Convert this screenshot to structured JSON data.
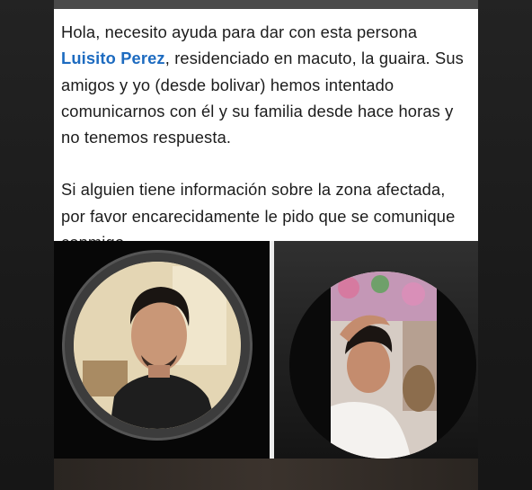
{
  "post": {
    "text_before_name": "Hola, necesito ayuda para dar con esta persona ",
    "name": "Luisito Perez",
    "text_after_name": ", residenciado en macuto, la guaira. Sus amigos y yo (desde bolivar) hemos intentado comunicarnos con él y su familia desde hace horas y no tenemos respuesta.",
    "paragraph_2": "Si alguien tiene información sobre la zona afectada, por favor encarecidamente le pido que se comunique conmigo"
  },
  "colors": {
    "name_link": "#1d6bc0",
    "text": "#1c1c1c",
    "background": "#1b1b1b"
  }
}
